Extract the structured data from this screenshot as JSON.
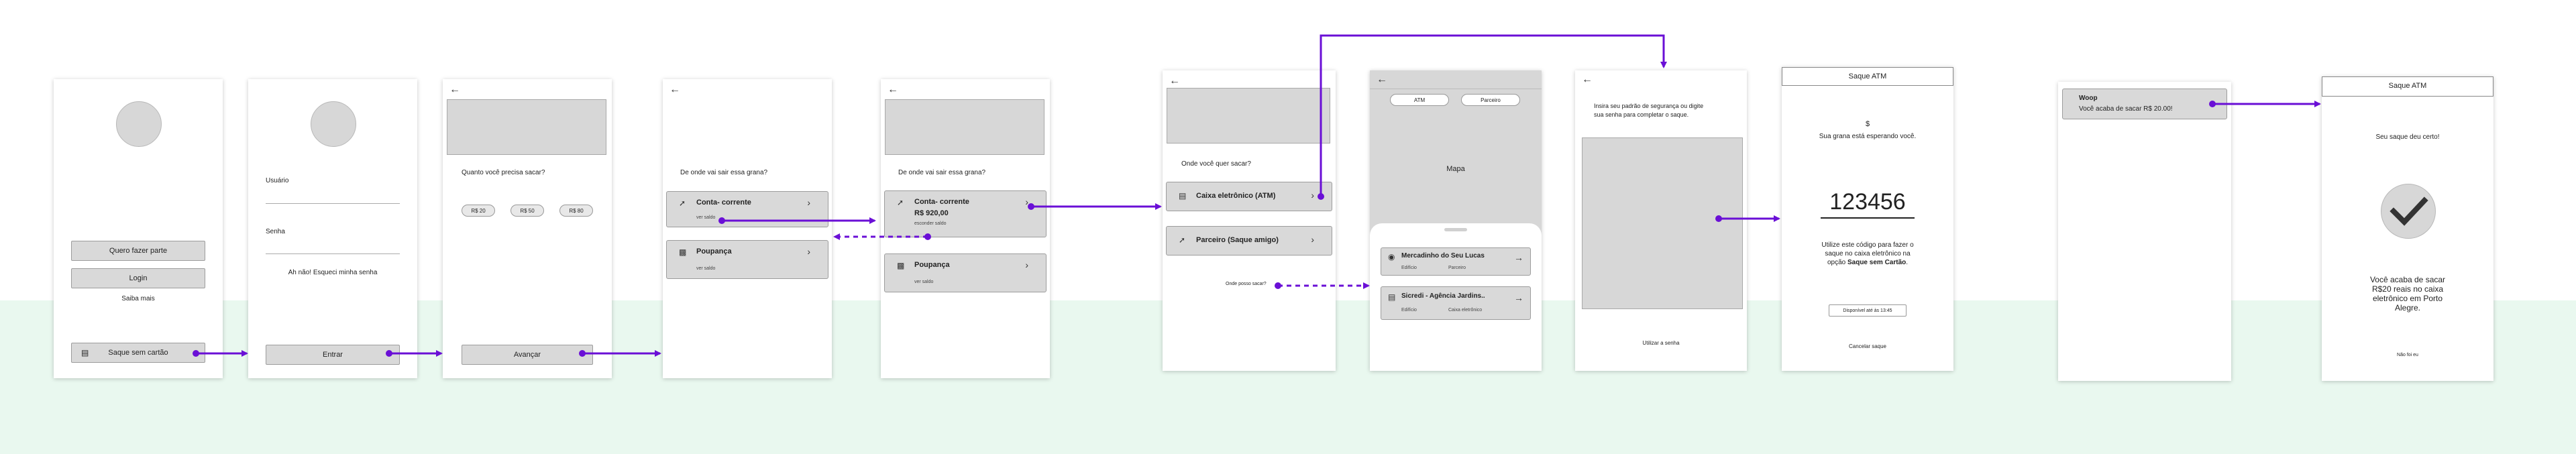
{
  "colors": {
    "arrow": "#6a0fd6",
    "band": "#e9f8ef",
    "screen": "#ffffff",
    "gray": "#d9d9d9"
  },
  "s1": {
    "quero": "Quero fazer parte",
    "login": "Login",
    "saiba": "Saiba mais",
    "saque": "Saque sem cartão",
    "saque_icon": "atm-icon"
  },
  "s2": {
    "usuario": "Usuário",
    "senha": "Senha",
    "esqueci": "Ah não! Esqueci minha senha",
    "entrar": "Entrar"
  },
  "s3": {
    "question": "Quanto você precisa sacar?",
    "chips": [
      "R$ 20",
      "R$ 50",
      "R$ 80"
    ],
    "avancar": "Avançar"
  },
  "s4": {
    "question": "De onde vai sair essa grana?",
    "conta": "Conta- corrente",
    "conta_sub": "ver saldo",
    "poupanca": "Poupança",
    "poupanca_sub": "ver saldo"
  },
  "s5": {
    "question": "De onde vai sair essa grana?",
    "conta": "Conta- corrente",
    "valor": "R$ 920,00",
    "conta_sub": "esconder saldo",
    "poupanca": "Poupança",
    "poupanca_sub": "ver saldo"
  },
  "s6": {
    "question": "Onde você quer sacar?",
    "caixa": "Caixa eletrônico (ATM)",
    "parceiro": "Parceiro (Saque amigo)",
    "onde": "Onde posso sacar?"
  },
  "s7": {
    "chip_atm": "ATM",
    "chip_parceiro": "Parceiro",
    "mapa": "Mapa",
    "loc1": {
      "name": "Mercadinho do Seu Lucas",
      "col1": "Edifício",
      "col2": "Parceiro"
    },
    "loc2": {
      "name": "Sicredi - Agência Jardins..",
      "col1": "Edifício",
      "col2": "Caixa eletrônico"
    }
  },
  "s8": {
    "instr1": "Insira seu padrão de segurança ou digite",
    "instr2": "sua senha para completar o saque.",
    "utilizar": "Utilizar a senha"
  },
  "s9": {
    "header": "Saque ATM",
    "greet": "Sua grana está esperando você.",
    "code": "123456",
    "info1": "Utilize este código para fazer o",
    "info2": "saque no caixa eletrônico na",
    "info3_a": "opção ",
    "info3_b": "Saque sem Cartão",
    "info3_c": ".",
    "disp": "Disponível até às 13:45",
    "cancelar": "Cancelar saque"
  },
  "s10": {
    "notif_title": "Woop",
    "notif_text": "Você acaba de sacar R$ 20.00!"
  },
  "s11": {
    "header": "Saque ATM",
    "title": "Seu saque deu certo!",
    "msg1": "Você acaba de sacar",
    "msg2": "R$20 reais no caixa",
    "msg3": "eletrônico em Porto",
    "msg4": "Alegre.",
    "nao": "Não foi eu"
  }
}
